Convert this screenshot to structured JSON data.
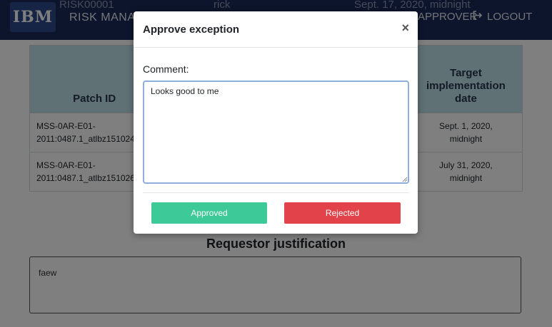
{
  "navbar": {
    "logo_text": "IBM",
    "brand": "RISK MANAGEMENT",
    "ghost_id": "RISK00001",
    "ghost_user": "rick",
    "ghost_date": "Sept. 17, 2020, midnight",
    "approver_label": "APPROVER",
    "logout_label": "LOGOUT"
  },
  "table": {
    "headers": [
      "Patch ID",
      "",
      "Target implementation date"
    ],
    "rows": [
      {
        "patch_line1": "MSS-0AR-E01-",
        "patch_line2": "2011:0487.1_atlbz151024",
        "date_line1": "Sept. 1, 2020,",
        "date_line2": "midnight"
      },
      {
        "patch_line1": "MSS-0AR-E01-",
        "patch_line2": "2011:0487.1_atlbz151026",
        "date_line1": "July 31, 2020,",
        "date_line2": "midnight"
      }
    ]
  },
  "justification": {
    "title": "Requestor justification",
    "text": "faew"
  },
  "modal": {
    "title": "Approve exception",
    "close_glyph": "×",
    "comment_label": "Comment:",
    "comment_value": "Looks good to me",
    "approve_label": "Approved",
    "reject_label": "Rejected"
  },
  "colors": {
    "navbar": "#1a2a59",
    "table_header": "#bfe3ea",
    "approve": "#3ec998",
    "reject": "#e2434b",
    "focus_border": "#8eaedb"
  },
  "icons": {
    "logout": "sign-out-icon"
  }
}
